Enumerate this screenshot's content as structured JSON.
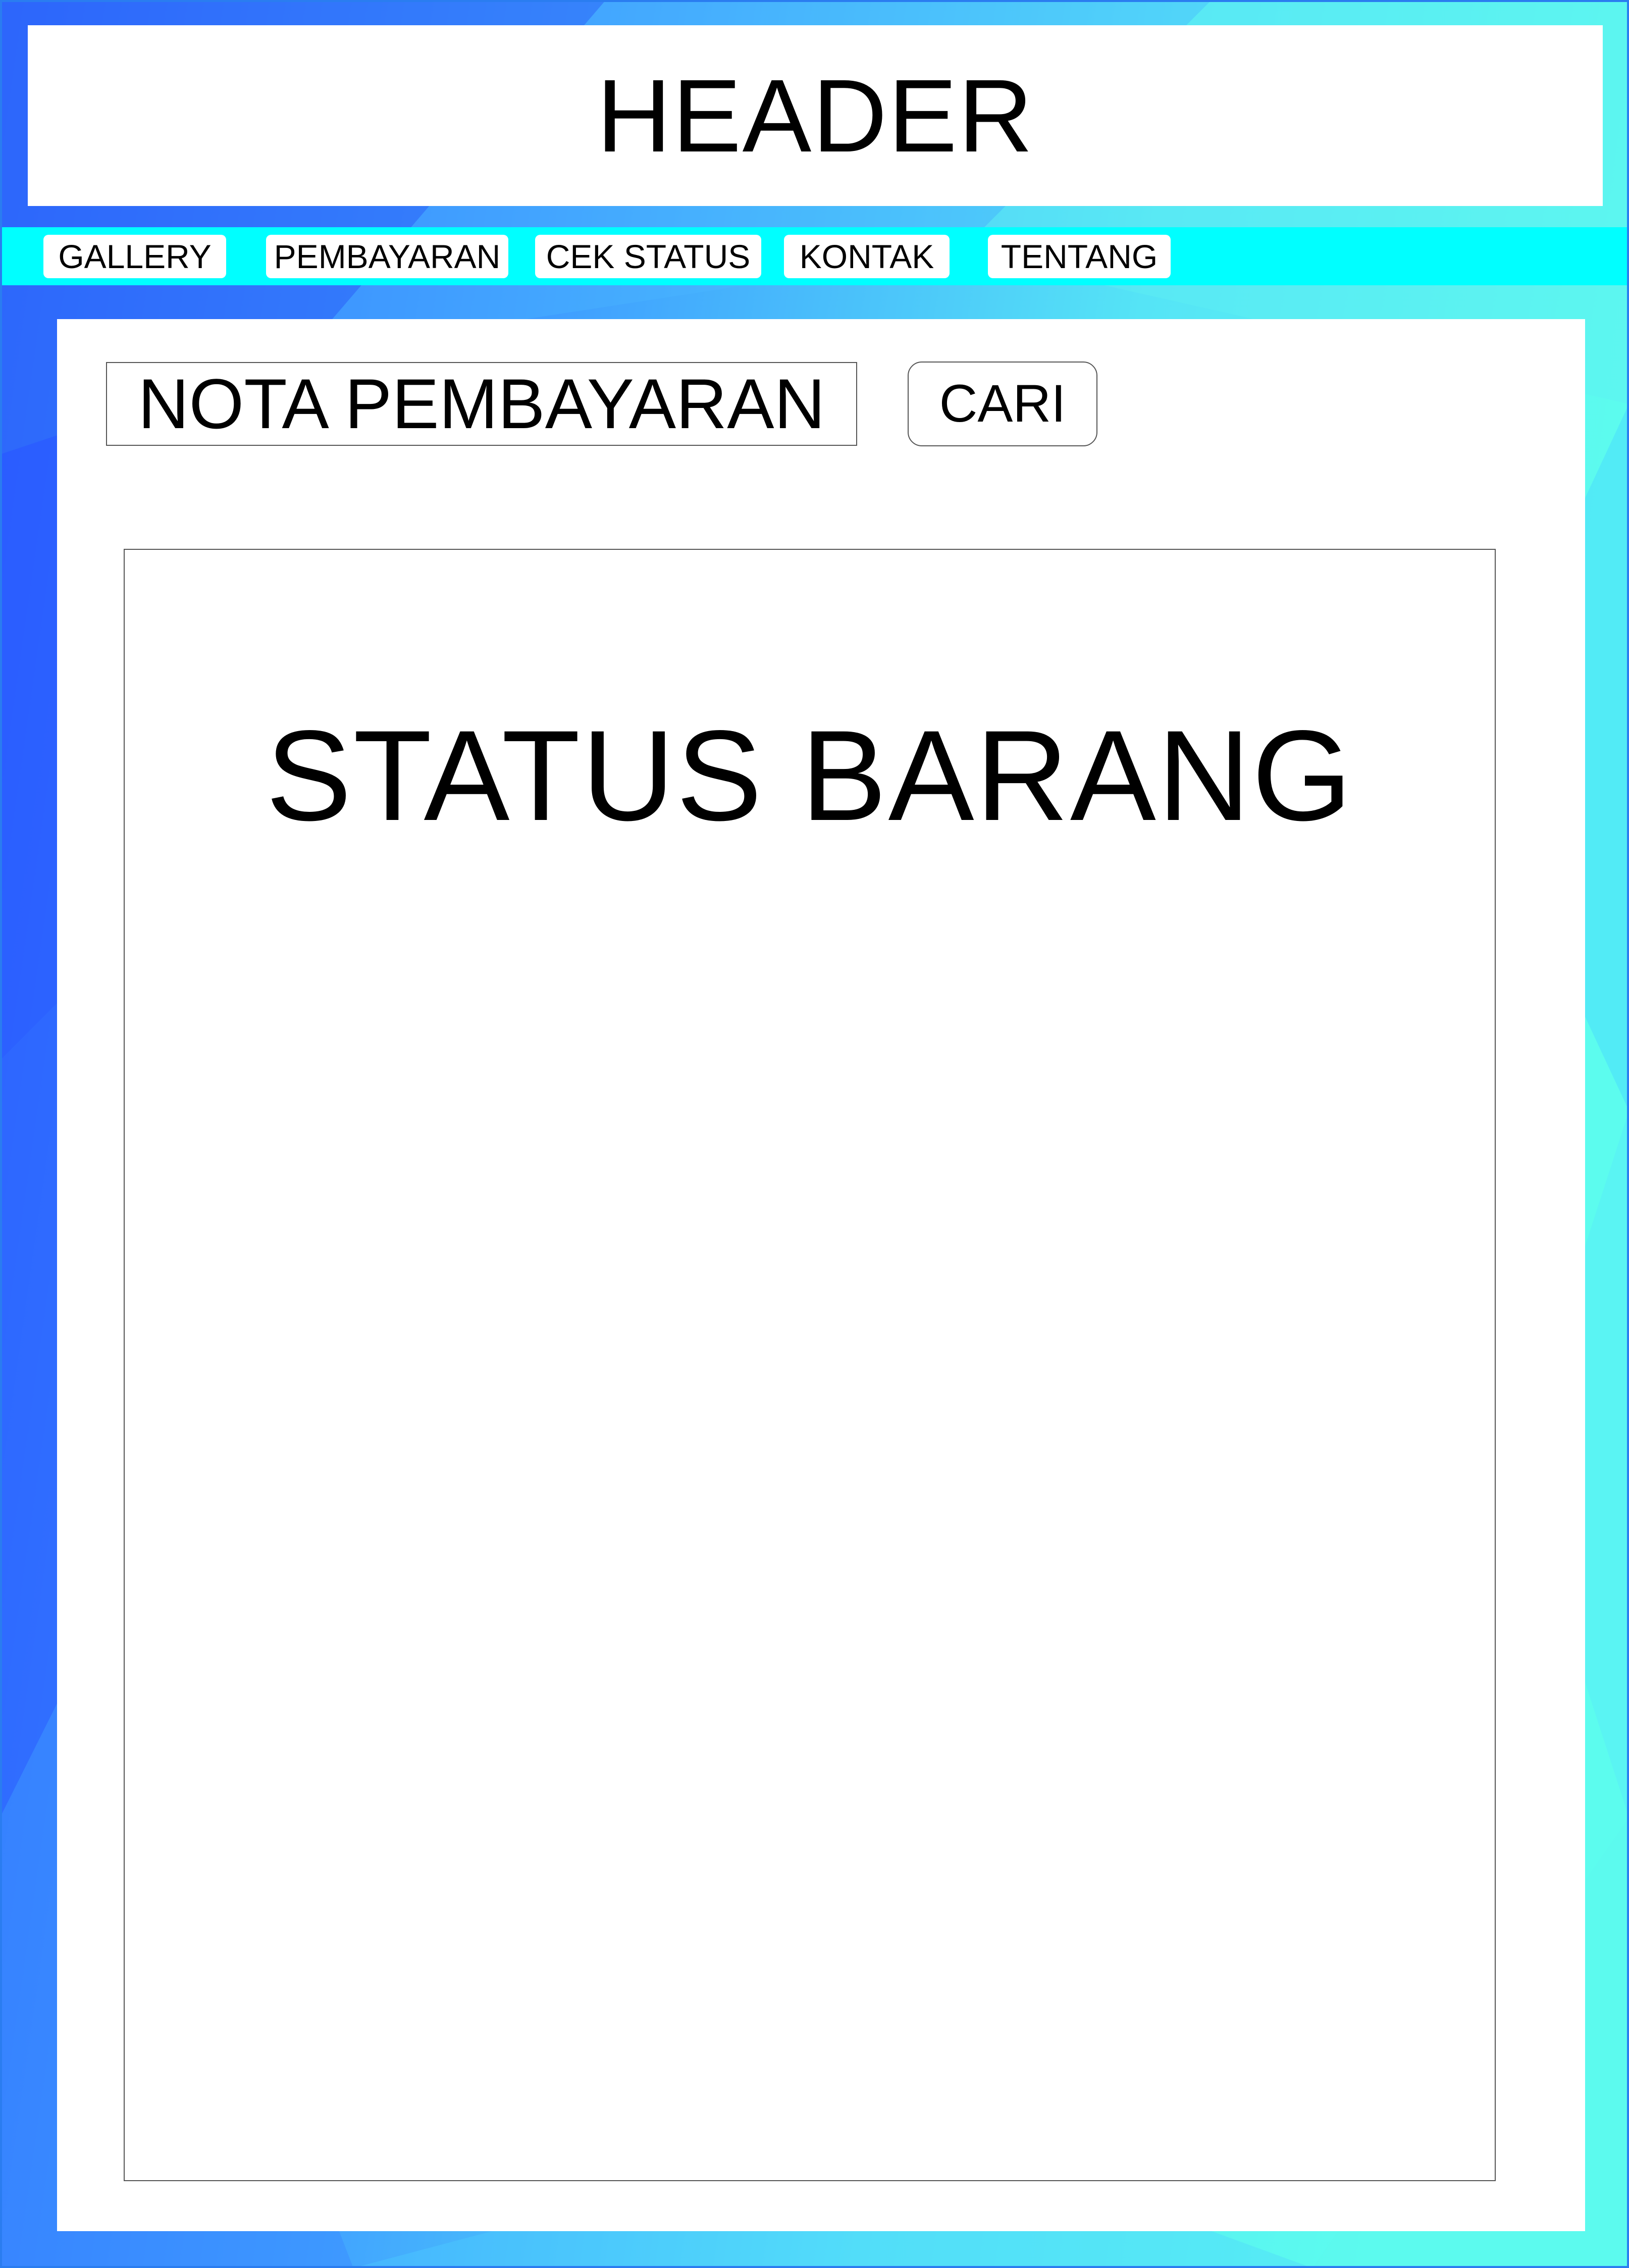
{
  "header": {
    "title": "HEADER"
  },
  "nav": {
    "items": [
      {
        "label": "GALLERY"
      },
      {
        "label": "PEMBAYARAN"
      },
      {
        "label": "CEK STATUS"
      },
      {
        "label": "KONTAK"
      },
      {
        "label": "TENTANG"
      }
    ]
  },
  "search": {
    "placeholder": "NOTA PEMBAYARAN",
    "value": "",
    "button_label": "CARI"
  },
  "status_panel": {
    "title": "STATUS BARANG"
  },
  "colors": {
    "nav_bar": "#00ffff",
    "background_blue": "#2a5cff",
    "background_cyan": "#5cf8f0",
    "panel": "#ffffff"
  }
}
